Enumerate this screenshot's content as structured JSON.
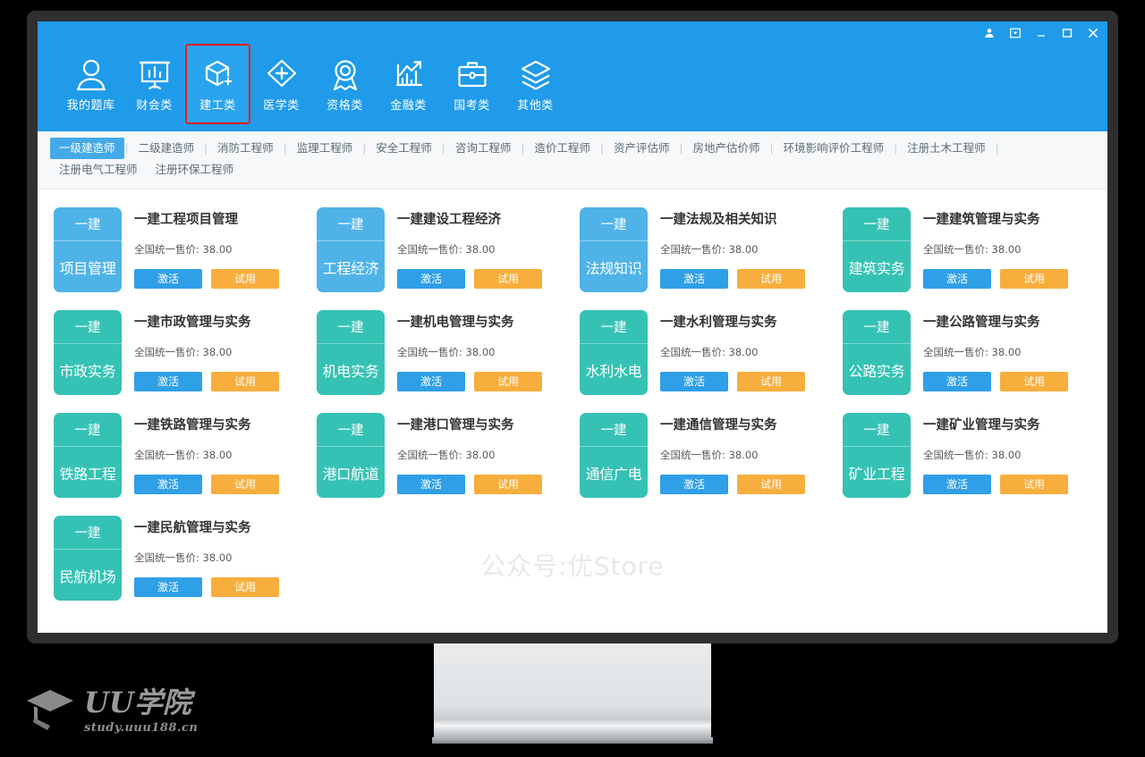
{
  "window": {
    "controls": [
      {
        "name": "user-icon",
        "label": "用户"
      },
      {
        "name": "restore-box-icon",
        "label": "窗口"
      },
      {
        "name": "minimize-icon",
        "label": "最小化"
      },
      {
        "name": "maximize-icon",
        "label": "最大化"
      },
      {
        "name": "close-icon",
        "label": "关闭"
      }
    ]
  },
  "primary_nav": {
    "active": "建工类",
    "annotation_color": "#ee1c1c",
    "items": [
      {
        "label": "我的题库",
        "icon": "user-icon"
      },
      {
        "label": "财会类",
        "icon": "chart-board-icon"
      },
      {
        "label": "建工类",
        "icon": "cube-plus-icon"
      },
      {
        "label": "医学类",
        "icon": "diamond-plus-icon"
      },
      {
        "label": "资格类",
        "icon": "medal-icon"
      },
      {
        "label": "金融类",
        "icon": "growth-chart-icon"
      },
      {
        "label": "国考类",
        "icon": "briefcase-icon"
      },
      {
        "label": "其他类",
        "icon": "layers-icon"
      }
    ]
  },
  "secondary_tabs": {
    "active": "一级建造师",
    "items": [
      "一级建造师",
      "二级建造师",
      "消防工程师",
      "监理工程师",
      "安全工程师",
      "咨询工程师",
      "造价工程师",
      "资产评估师",
      "房地产估价师",
      "环境影响评价工程师",
      "注册土木工程师",
      "注册电气工程师",
      "注册环保工程师"
    ]
  },
  "buttons": {
    "activate": "激活",
    "trial": "试用"
  },
  "colors": {
    "brand_blue": "#1f9bea",
    "thumb_blue": "#4fb3e8",
    "thumb_teal": "#35c2b4",
    "activate_blue": "#2f9fe8",
    "trial_orange": "#f8ae3c"
  },
  "courses": [
    {
      "badge": "一建",
      "subject": "项目管理",
      "title": "一建工程项目管理",
      "price": "全国统一售价: 38.00",
      "color": "blue"
    },
    {
      "badge": "一建",
      "subject": "工程经济",
      "title": "一建建设工程经济",
      "price": "全国统一售价: 38.00",
      "color": "blue"
    },
    {
      "badge": "一建",
      "subject": "法规知识",
      "title": "一建法规及相关知识",
      "price": "全国统一售价: 38.00",
      "color": "blue"
    },
    {
      "badge": "一建",
      "subject": "建筑实务",
      "title": "一建建筑管理与实务",
      "price": "全国统一售价: 38.00",
      "color": "teal"
    },
    {
      "badge": "一建",
      "subject": "市政实务",
      "title": "一建市政管理与实务",
      "price": "全国统一售价: 38.00",
      "color": "teal"
    },
    {
      "badge": "一建",
      "subject": "机电实务",
      "title": "一建机电管理与实务",
      "price": "全国统一售价: 38.00",
      "color": "teal"
    },
    {
      "badge": "一建",
      "subject": "水利水电",
      "title": "一建水利管理与实务",
      "price": "全国统一售价: 38.00",
      "color": "teal"
    },
    {
      "badge": "一建",
      "subject": "公路实务",
      "title": "一建公路管理与实务",
      "price": "全国统一售价: 38.00",
      "color": "teal"
    },
    {
      "badge": "一建",
      "subject": "铁路工程",
      "title": "一建铁路管理与实务",
      "price": "全国统一售价: 38.00",
      "color": "teal"
    },
    {
      "badge": "一建",
      "subject": "港口航道",
      "title": "一建港口管理与实务",
      "price": "全国统一售价: 38.00",
      "color": "teal"
    },
    {
      "badge": "一建",
      "subject": "通信广电",
      "title": "一建通信管理与实务",
      "price": "全国统一售价: 38.00",
      "color": "teal"
    },
    {
      "badge": "一建",
      "subject": "矿业工程",
      "title": "一建矿业管理与实务",
      "price": "全国统一售价: 38.00",
      "color": "teal"
    },
    {
      "badge": "一建",
      "subject": "民航机场",
      "title": "一建民航管理与实务",
      "price": "全国统一售价: 38.00",
      "color": "teal"
    }
  ],
  "watermark": "公众号:优Store",
  "brand": {
    "name": "UU学院",
    "url": "study.uuu188.cn"
  }
}
